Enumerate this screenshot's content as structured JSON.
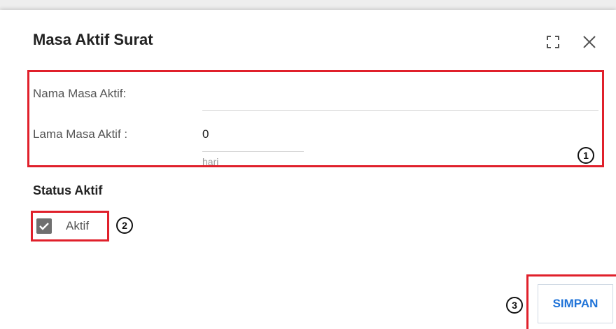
{
  "dialog": {
    "title": "Masa Aktif Surat",
    "icons": {
      "fullscreen": "fullscreen-icon",
      "close": "close-icon"
    }
  },
  "form": {
    "nama_label": "Nama Masa Aktif:",
    "nama_value": "",
    "lama_label": "Lama Masa Aktif :",
    "lama_value": "0",
    "lama_unit": "hari"
  },
  "status": {
    "title": "Status Aktif",
    "checkbox_label": "Aktif",
    "checked": true
  },
  "actions": {
    "save_label": "SIMPAN"
  },
  "callouts": [
    "1",
    "2",
    "3"
  ],
  "colors": {
    "highlight": "#e0202b",
    "primary": "#1f73d8",
    "checkbox": "#6f6f6f"
  }
}
